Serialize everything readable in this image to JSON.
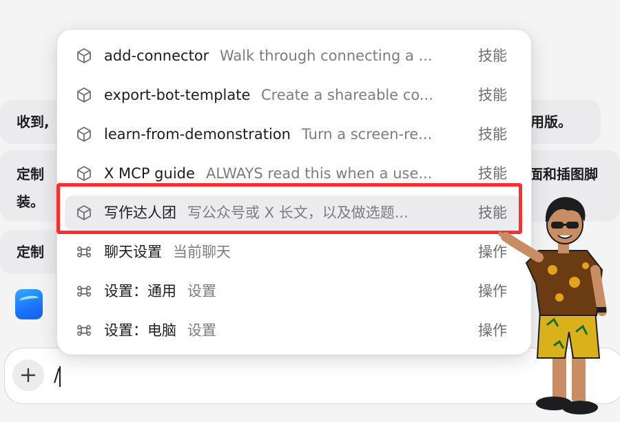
{
  "chat": {
    "bubble1_left": "收到,",
    "bubble1_right": "用版。",
    "bubble2_left": "定制",
    "bubble2_left_line2": "装。",
    "bubble2_right": "面和插图脚",
    "bubble3_left": "定制"
  },
  "command_menu": {
    "items": [
      {
        "name": "add-connector",
        "description": "Walk through connecting a ...",
        "tag": "技能",
        "icon": "cube-icon",
        "selected": false
      },
      {
        "name": "export-bot-template",
        "description": "Create a shareable co...",
        "tag": "技能",
        "icon": "cube-icon",
        "selected": false
      },
      {
        "name": "learn-from-demonstration",
        "description": "Turn a screen-re...",
        "tag": "技能",
        "icon": "cube-icon",
        "selected": false
      },
      {
        "name": "X MCP guide",
        "description": "ALWAYS read this when a use...",
        "tag": "技能",
        "icon": "cube-icon",
        "selected": false
      },
      {
        "name": "写作达人团",
        "description": "写公众号或 X 长文，以及做选题...",
        "tag": "技能",
        "icon": "cube-icon",
        "selected": true
      },
      {
        "name": "聊天设置",
        "description": "当前聊天",
        "tag": "操作",
        "icon": "command-icon",
        "selected": false
      },
      {
        "name": "设置：通用",
        "description": "设置",
        "tag": "操作",
        "icon": "command-icon",
        "selected": false
      },
      {
        "name": "设置：电脑",
        "description": "设置",
        "tag": "操作",
        "icon": "command-icon",
        "selected": false
      }
    ]
  },
  "composer": {
    "value": "/"
  },
  "colors": {
    "highlight_box": "#ff2d2d",
    "selected_row_bg": "#ececee",
    "app_badge": "#1a73ff"
  }
}
